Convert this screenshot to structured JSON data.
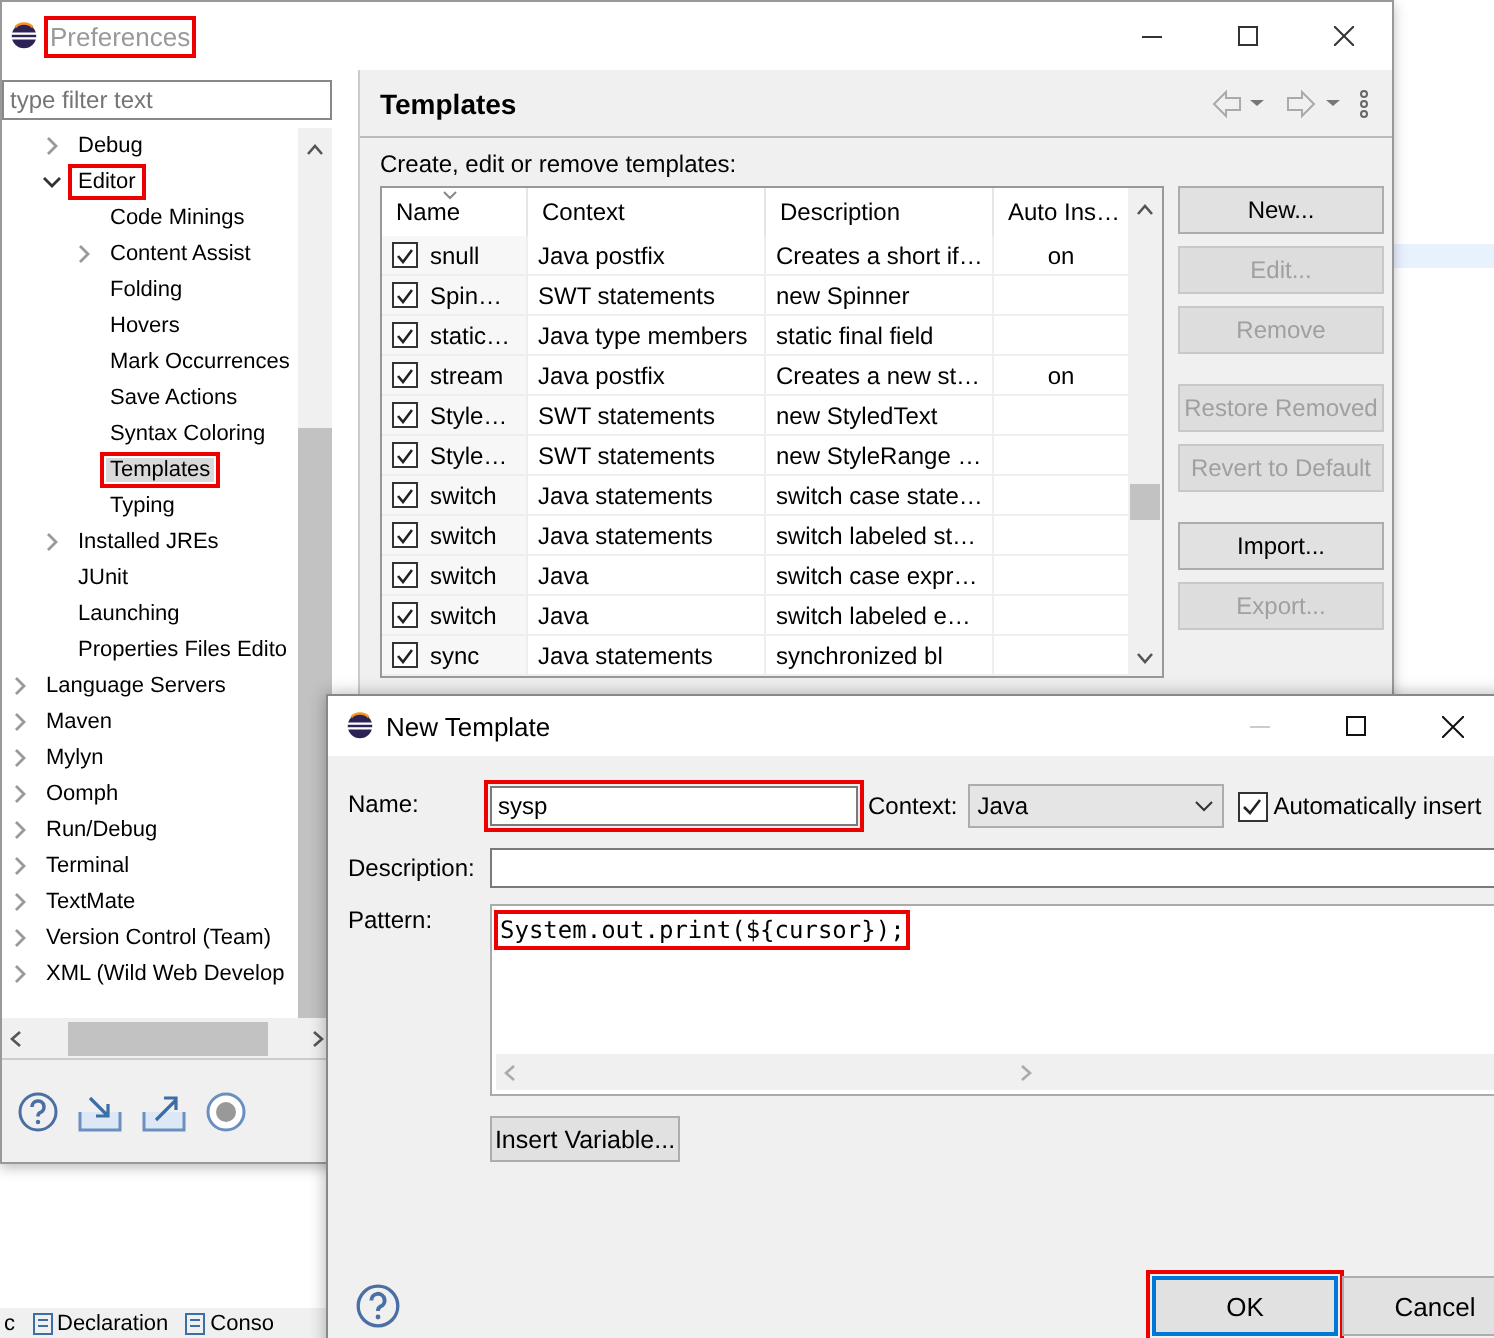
{
  "preferences_window": {
    "title": "Preferences",
    "highlighted": true,
    "filter": {
      "placeholder": "type filter text"
    },
    "tree": {
      "hidden_parent_children": [
        {
          "label": "Debug",
          "kind": "collapsed",
          "selected": false,
          "highlighted": false
        },
        {
          "label": "Editor",
          "kind": "expanded",
          "selected": false,
          "highlighted": true,
          "children": [
            {
              "label": "Code Minings",
              "kind": "leaf",
              "selected": false,
              "highlighted": false
            },
            {
              "label": "Content Assist",
              "kind": "collapsed",
              "selected": false,
              "highlighted": false
            },
            {
              "label": "Folding",
              "kind": "leaf",
              "selected": false,
              "highlighted": false
            },
            {
              "label": "Hovers",
              "kind": "leaf",
              "selected": false,
              "highlighted": false
            },
            {
              "label": "Mark Occurrences",
              "kind": "leaf",
              "selected": false,
              "highlighted": false
            },
            {
              "label": "Save Actions",
              "kind": "leaf",
              "selected": false,
              "highlighted": false
            },
            {
              "label": "Syntax Coloring",
              "kind": "leaf",
              "selected": false,
              "highlighted": false
            },
            {
              "label": "Templates",
              "kind": "leaf",
              "selected": true,
              "highlighted": true
            },
            {
              "label": "Typing",
              "kind": "leaf",
              "selected": false,
              "highlighted": false
            }
          ]
        },
        {
          "label": "Installed JREs",
          "kind": "collapsed",
          "selected": false,
          "highlighted": false
        },
        {
          "label": "JUnit",
          "kind": "leaf",
          "selected": false,
          "highlighted": false
        },
        {
          "label": "Launching",
          "kind": "leaf",
          "selected": false,
          "highlighted": false
        },
        {
          "label": "Properties Files Edito",
          "kind": "leaf",
          "selected": false,
          "highlighted": false
        }
      ],
      "items": [
        {
          "label": "Language Servers",
          "kind": "collapsed",
          "selected": false,
          "highlighted": false
        },
        {
          "label": "Maven",
          "kind": "collapsed",
          "selected": false,
          "highlighted": false
        },
        {
          "label": "Mylyn",
          "kind": "collapsed",
          "selected": false,
          "highlighted": false
        },
        {
          "label": "Oomph",
          "kind": "collapsed",
          "selected": false,
          "highlighted": false
        },
        {
          "label": "Run/Debug",
          "kind": "collapsed",
          "selected": false,
          "highlighted": false
        },
        {
          "label": "Terminal",
          "kind": "collapsed",
          "selected": false,
          "highlighted": false
        },
        {
          "label": "TextMate",
          "kind": "collapsed",
          "selected": false,
          "highlighted": false
        },
        {
          "label": "Version Control (Team)",
          "kind": "collapsed",
          "selected": false,
          "highlighted": false
        },
        {
          "label": "XML (Wild Web Develop",
          "kind": "collapsed",
          "selected": false,
          "highlighted": false
        }
      ]
    },
    "page": {
      "title": "Templates",
      "intro": "Create, edit or remove templates:",
      "table": {
        "columns": [
          {
            "label": "Name",
            "sorted": true
          },
          {
            "label": "Context",
            "sorted": false
          },
          {
            "label": "Description",
            "sorted": false
          },
          {
            "label": "Auto Ins…",
            "sorted": false
          }
        ],
        "rows": [
          {
            "checked": true,
            "name": "snull",
            "context": "Java postfix",
            "description": "Creates a short if…",
            "auto_insert": "on"
          },
          {
            "checked": true,
            "name": "Spin…",
            "context": "SWT statements",
            "description": "new Spinner"
          },
          {
            "checked": true,
            "name": "static…",
            "context": "Java type members",
            "description": "static final field"
          },
          {
            "checked": true,
            "name": "stream",
            "context": "Java postfix",
            "description": "Creates a new st…",
            "auto_insert": "on"
          },
          {
            "checked": true,
            "name": "Style…",
            "context": "SWT statements",
            "description": "new StyledText"
          },
          {
            "checked": true,
            "name": "Style…",
            "context": "SWT statements",
            "description": "new StyleRange …"
          },
          {
            "checked": true,
            "name": "switch",
            "context": "Java statements",
            "description": "switch case state…"
          },
          {
            "checked": true,
            "name": "switch",
            "context": "Java statements",
            "description": "switch labeled st…"
          },
          {
            "checked": true,
            "name": "switch",
            "context": "Java",
            "description": "switch case expr…"
          },
          {
            "checked": true,
            "name": "switch",
            "context": "Java",
            "description": "switch labeled e…"
          },
          {
            "checked": true,
            "name": "sync",
            "context": "Java statements",
            "description": "synchronized bl"
          }
        ]
      },
      "buttons": [
        {
          "label": "New...",
          "disabled": false
        },
        {
          "label": "Edit...",
          "disabled": true
        },
        {
          "label": "Remove",
          "disabled": true
        },
        {
          "label": "Restore Removed",
          "disabled": true
        },
        {
          "label": "Revert to Default",
          "disabled": true
        },
        {
          "label": "Import...",
          "disabled": false
        },
        {
          "label": "Export...",
          "disabled": true
        }
      ]
    }
  },
  "background_tabs": [
    {
      "label": "c"
    },
    {
      "label": "Declaration"
    },
    {
      "label": "Conso"
    }
  ],
  "dialog": {
    "title": "New Template",
    "name": {
      "label": "Name:",
      "value": "sysp",
      "highlighted": true
    },
    "context": {
      "label": "Context:",
      "value": "Java"
    },
    "auto_insert": {
      "label": "Automatically insert",
      "checked": true
    },
    "description": {
      "label": "Description:"
    },
    "pattern": {
      "label": "Pattern:",
      "value": "System.out.print(${cursor});",
      "highlighted": true
    },
    "insert_variable": "Insert Variable...",
    "buttons": [
      {
        "label": "OK",
        "default": true,
        "highlighted": true
      },
      {
        "label": "Cancel",
        "default": false,
        "highlighted": false
      }
    ]
  }
}
